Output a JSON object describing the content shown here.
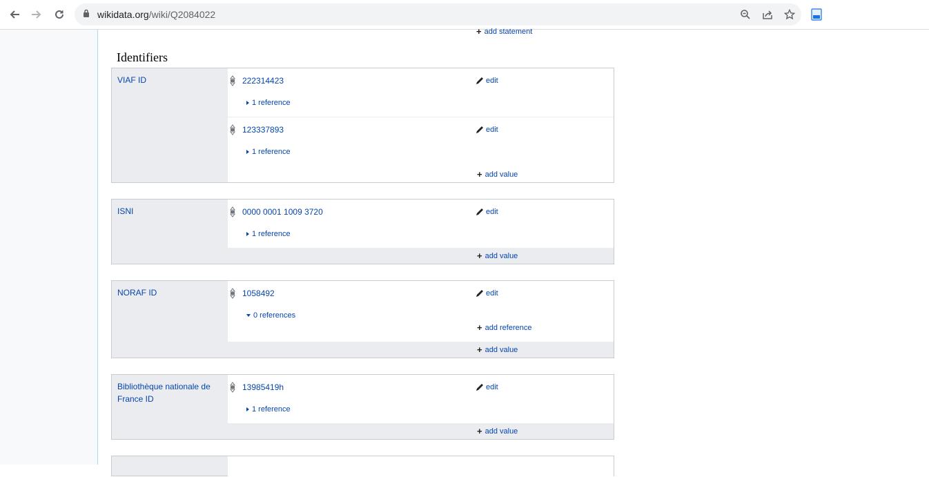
{
  "browser": {
    "url_host": "wikidata.org",
    "url_path": "/wiki/Q2084022"
  },
  "page": {
    "top_add_statement": "add statement",
    "section_title": "Identifiers",
    "edit_label": "edit",
    "add_value_label": "add value",
    "add_reference_label": "add reference",
    "groups": [
      {
        "property": "VIAF ID",
        "statements": [
          {
            "value": "222314423",
            "references": "1 reference"
          },
          {
            "value": "123337893",
            "references": "1 reference"
          }
        ]
      },
      {
        "property": "ISNI",
        "statements": [
          {
            "value": "0000 0001 1009 3720",
            "references": "1 reference"
          }
        ]
      },
      {
        "property": "NORAF ID",
        "statements": [
          {
            "value": "1058492",
            "references": "0 references"
          }
        ]
      },
      {
        "property": "Bibliothèque nationale de France ID",
        "statements": [
          {
            "value": "13985419h",
            "references": "1 reference"
          }
        ]
      }
    ]
  }
}
